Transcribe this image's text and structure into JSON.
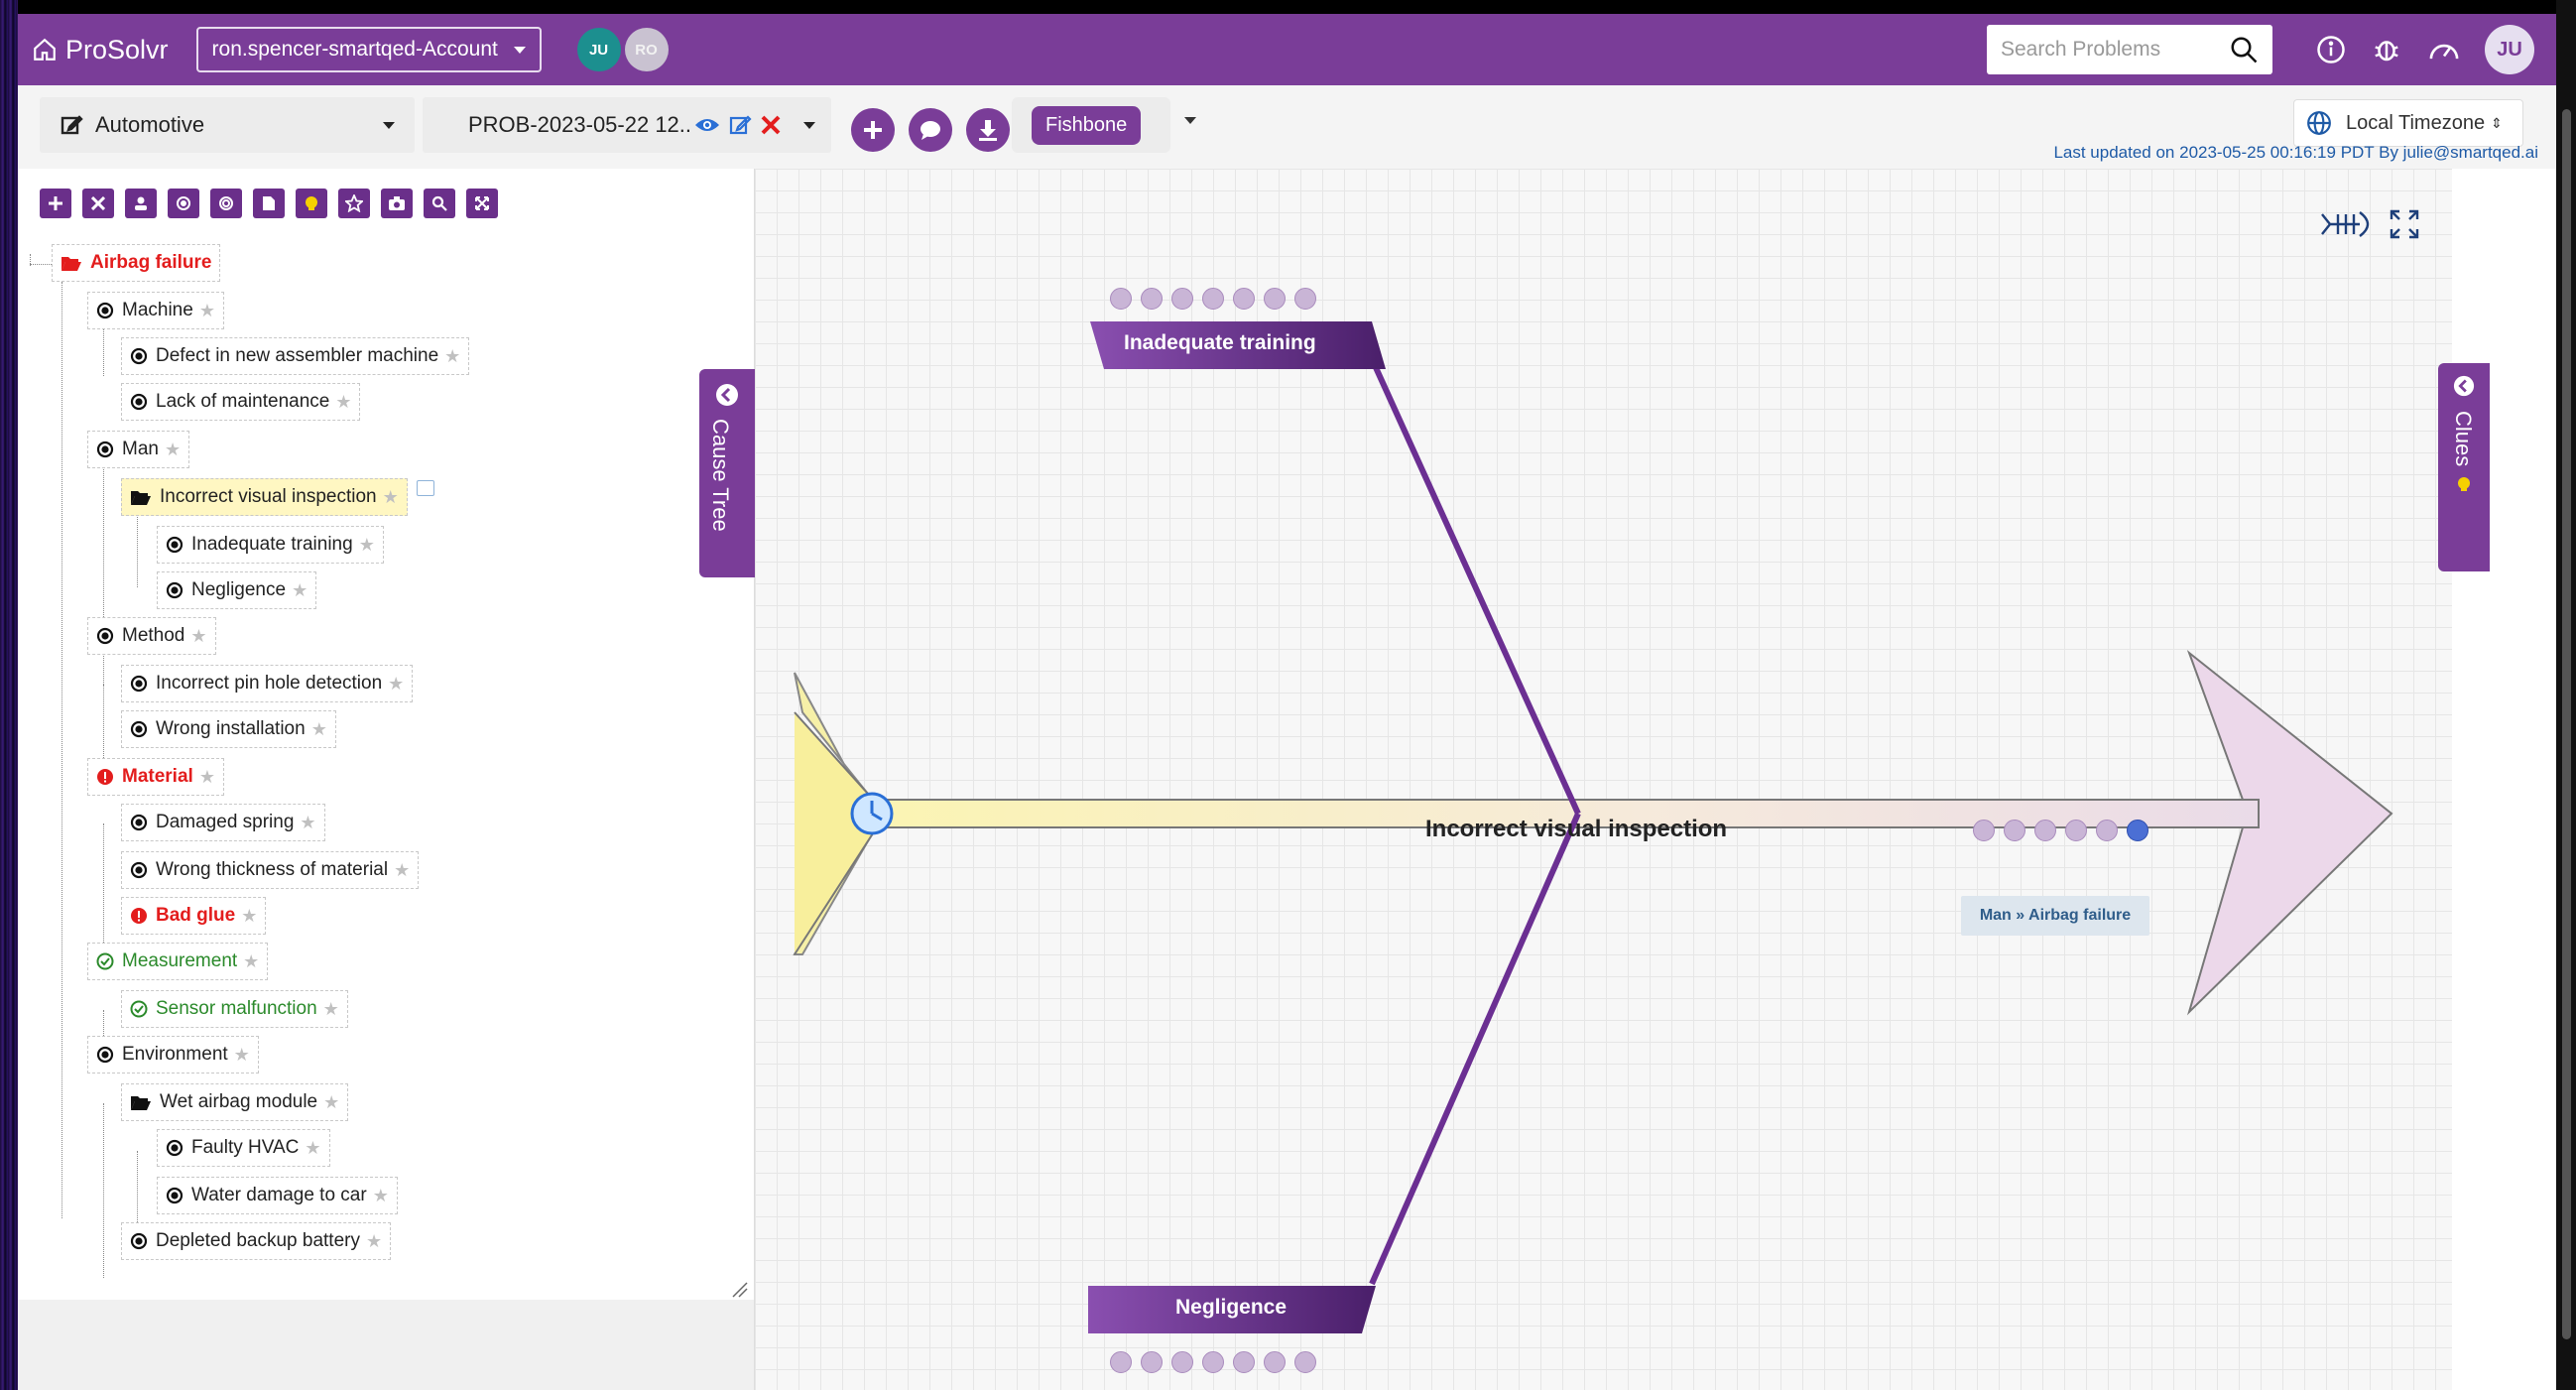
{
  "app": {
    "brand": "ProSolvr",
    "account": "ron.spencer-smartqed-Account",
    "avatars": [
      "JU",
      "RO"
    ],
    "search_placeholder": "Search Problems",
    "user_initials": "JU"
  },
  "toolbar": {
    "industry": "Automotive",
    "problem_id": "PROB-2023-05-22 12..",
    "view_mode": "Fishbone",
    "timezone": "Local Timezone",
    "last_updated": "Last updated on 2023-05-25 00:16:19 PDT By julie@smartqed.ai"
  },
  "side_tabs": {
    "cause_tree": "Cause Tree",
    "clues": "Clues"
  },
  "tree": {
    "root": "Airbag failure",
    "nodes": {
      "machine": "Machine",
      "defect_assembler": "Defect in new assembler machine",
      "lack_maintenance": "Lack of maintenance",
      "man": "Man",
      "incorrect_visual": "Incorrect visual inspection",
      "inadequate_training": "Inadequate training",
      "negligence": "Negligence",
      "method": "Method",
      "pin_hole": "Incorrect pin hole detection",
      "wrong_install": "Wrong installation",
      "material": "Material",
      "damaged_spring": "Damaged spring",
      "wrong_thickness": "Wrong thickness of material",
      "bad_glue": "Bad glue",
      "measurement": "Measurement",
      "sensor": "Sensor malfunction",
      "environment": "Environment",
      "wet_airbag": "Wet airbag module",
      "faulty_hvac": "Faulty HVAC",
      "water_damage": "Water damage to car",
      "depleted_battery": "Depleted backup battery"
    }
  },
  "fishbone": {
    "head": "Incorrect visual inspection",
    "bone_top": "Inadequate training",
    "bone_bottom": "Negligence",
    "breadcrumb": "Man » Airbag failure"
  },
  "colors": {
    "brand": "#7a3d98",
    "red": "#e31d1d",
    "green": "#2b8a2b"
  }
}
